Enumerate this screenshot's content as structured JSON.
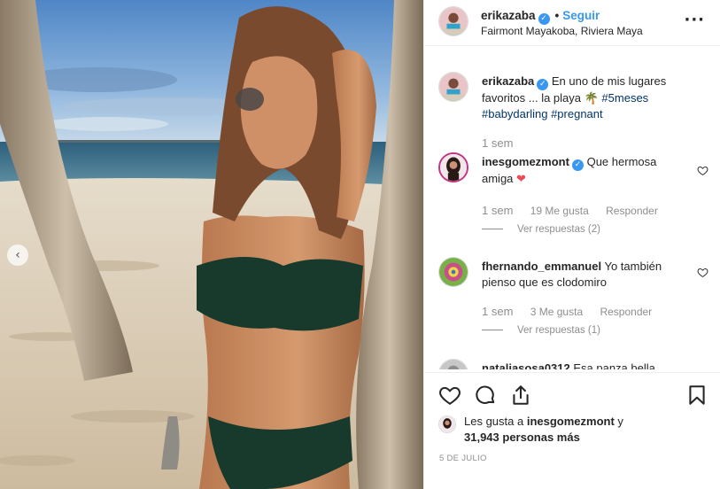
{
  "post": {
    "username": "erikazaba",
    "follow_label": "Seguir",
    "location": "Fairmont Mayakoba, Riviera Maya",
    "more_label": "···"
  },
  "caption": {
    "username": "erikazaba",
    "text": "En uno de mis lugares favoritos ... la playa 🌴",
    "tags": [
      "#5meses",
      "#babydarling",
      "#pregnant"
    ],
    "time": "1 sem"
  },
  "comments": [
    {
      "username": "inesgomezmont",
      "text": "Que hermosa amiga",
      "emoji": "❤",
      "time": "1 sem",
      "likes": "19 Me gusta",
      "reply_label": "Responder",
      "view_replies": "Ver respuestas (2)"
    },
    {
      "username": "fhernando_emmanuel",
      "text": "Yo también pienso que es clodomiro",
      "time": "1 sem",
      "likes": "3 Me gusta",
      "reply_label": "Responder",
      "view_replies": "Ver respuestas (1)"
    },
    {
      "username": "nataliasosa0312",
      "text": "Esa panza bella"
    }
  ],
  "footer": {
    "likes_prefix": "Les gusta a ",
    "likes_user": "inesgomezmont",
    "likes_suffix": " y",
    "likes_count": "31,943 personas más",
    "date": "5 DE JULIO"
  },
  "colors": {
    "link": "#3897f0",
    "hashtag": "#003569",
    "muted": "#8e8e8e",
    "heart_red": "#ed4956"
  },
  "icons": [
    "prev-arrow-icon",
    "verified-badge-icon",
    "more-options-icon",
    "heart-icon",
    "comment-icon",
    "share-icon",
    "bookmark-icon"
  ]
}
